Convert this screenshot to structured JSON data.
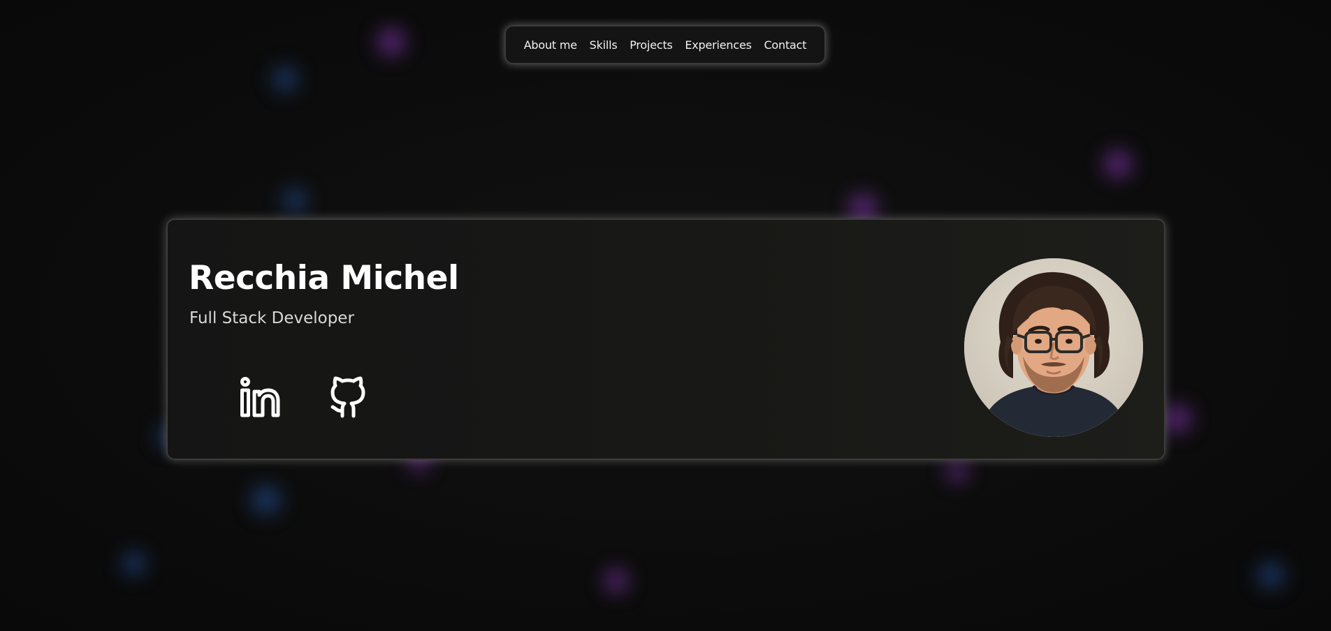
{
  "nav": {
    "items": [
      {
        "label": "About me"
      },
      {
        "label": "Skills"
      },
      {
        "label": "Projects"
      },
      {
        "label": "Experiences"
      },
      {
        "label": "Contact"
      }
    ]
  },
  "hero": {
    "name": "Recchia Michel",
    "role": "Full Stack Developer",
    "socials": [
      {
        "icon": "linkedin-icon"
      },
      {
        "icon": "github-icon"
      }
    ],
    "avatar_icon": "profile-portrait"
  },
  "colors": {
    "background": "#0b0b0b",
    "card": "#181816",
    "text": "#ffffff",
    "subtext": "#d9d9d9"
  }
}
